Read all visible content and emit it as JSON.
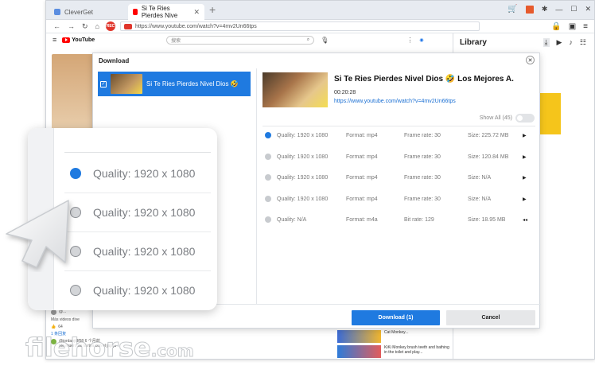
{
  "browser": {
    "tabs": [
      {
        "label": "CleverGet"
      },
      {
        "label": "Si Te Ries Pierdes Nive"
      }
    ],
    "url": "https://www.youtube.com/watch?v=4mv2Un66tps"
  },
  "youtube": {
    "logo": "YouTube",
    "search_placeholder": "搜索",
    "comments": [
      {
        "text": "@..."
      },
      {
        "text": "Más videos dive"
      },
      {
        "likes": "64"
      },
      {
        "text": "1 条回复"
      },
      {
        "text": "@jordanjt8f58 6 个月前"
      },
      {
        "text": "Me muero de la risa con el jajaja"
      }
    ],
    "related": [
      {
        "title": "Cat Monkey..."
      },
      {
        "title": "KiKi Monkey brush teeth and bathing in the toilet and play..."
      }
    ]
  },
  "library": {
    "title": "Library"
  },
  "dialog": {
    "title": "Download",
    "selected_item": "Si Te Ries Pierdes Nivel Dios 🤣",
    "video": {
      "title": "Si Te Ries Pierdes Nivel Dios 🤣 Los Mejores A.",
      "duration": "00:20:28",
      "url": "https://www.youtube.com/watch?v=4mv2Un66tps"
    },
    "show_all": "Show All (45)",
    "rows": [
      {
        "quality": "Quality: 1920 x 1080",
        "format": "Format: mp4",
        "rate": "Frame rate: 30",
        "size": "Size: 225.72 MB",
        "selected": true,
        "icon": "video-icon"
      },
      {
        "quality": "Quality: 1920 x 1080",
        "format": "Format: mp4",
        "rate": "Frame rate: 30",
        "size": "Size: 120.84 MB",
        "selected": false,
        "icon": "video-icon"
      },
      {
        "quality": "Quality: 1920 x 1080",
        "format": "Format: mp4",
        "rate": "Frame rate: 30",
        "size": "Size: N/A",
        "selected": false,
        "icon": "video-icon"
      },
      {
        "quality": "Quality: 1920 x 1080",
        "format": "Format: mp4",
        "rate": "Frame rate: 30",
        "size": "Size: N/A",
        "selected": false,
        "icon": "video-icon"
      },
      {
        "quality": "Quality: N/A",
        "format": "Format: m4a",
        "rate": "Bit rate: 129",
        "size": "Size: 18.95 MB",
        "selected": false,
        "icon": "audio-icon"
      }
    ],
    "download_label": "Download (1)",
    "cancel_label": "Cancel"
  },
  "zoom": {
    "rows": [
      {
        "label": "Quality: 1920 x 1080",
        "selected": true
      },
      {
        "label": "Quality: 1920 x 1080",
        "selected": false
      },
      {
        "label": "Quality: 1920 x 1080",
        "selected": false
      },
      {
        "label": "Quality: 1920 x 1080",
        "selected": false
      }
    ]
  },
  "watermark": {
    "text": "filehorse",
    "suffix": ".com"
  },
  "colors": {
    "accent": "#1f7ae0",
    "youtube_red": "#ff0000",
    "record_red": "#e0352b"
  }
}
